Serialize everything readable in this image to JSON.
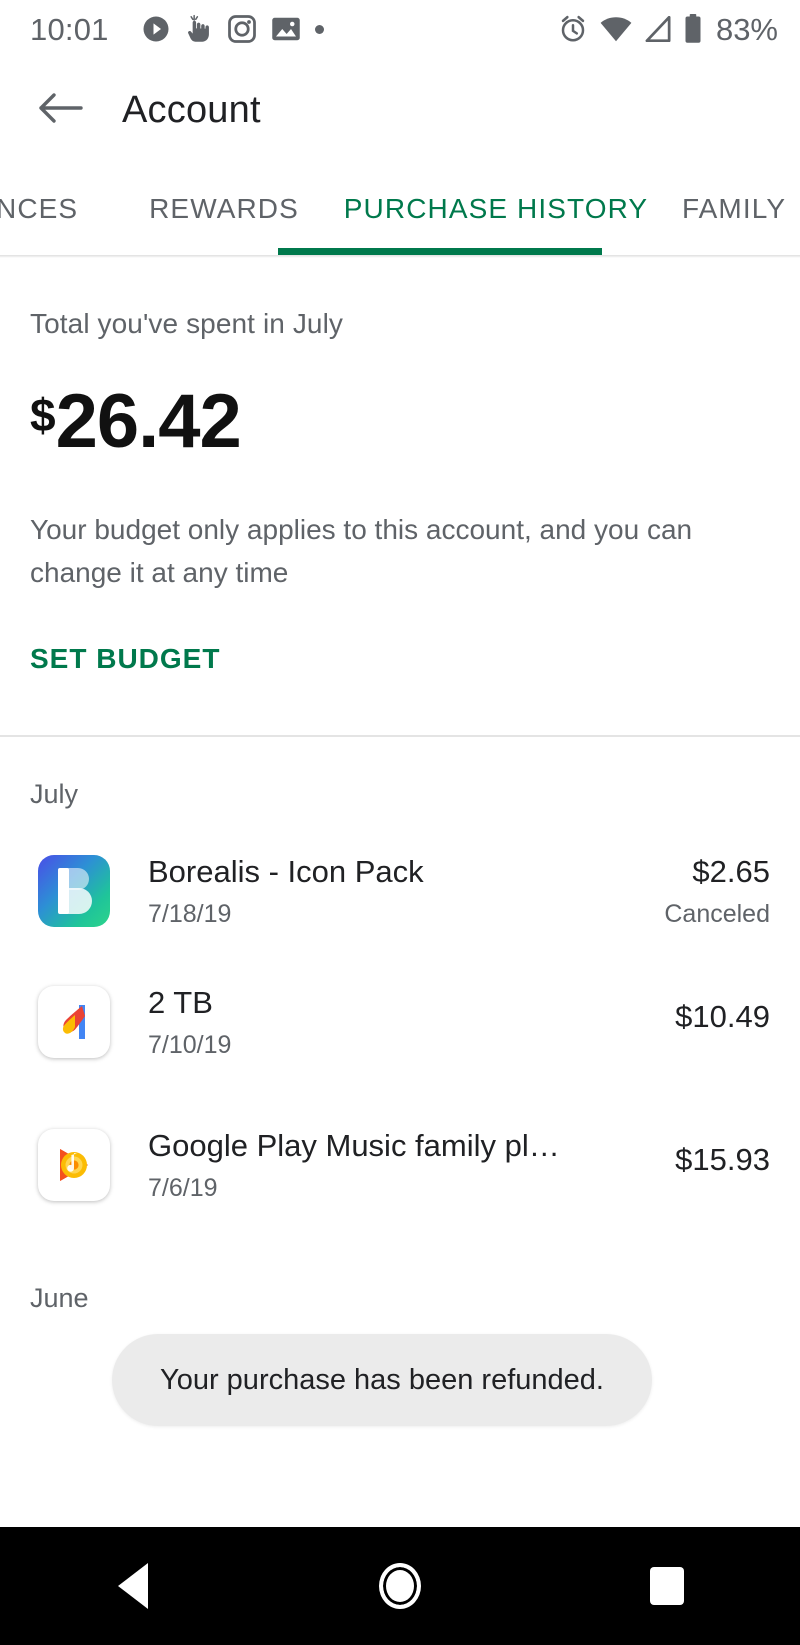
{
  "status_bar": {
    "time": "10:01",
    "battery_percent": "83%",
    "left_icons": [
      "play-circle-icon",
      "touch-pointer-icon",
      "instagram-icon",
      "image-icon",
      "dot-icon"
    ],
    "right_icons": [
      "alarm-icon",
      "wifi-icon",
      "cellular-signal-icon",
      "battery-icon"
    ]
  },
  "app_bar": {
    "back_icon": "arrow-back-icon",
    "title": "Account"
  },
  "tabs": {
    "items": [
      {
        "label": "NCES",
        "active": false
      },
      {
        "label": "REWARDS",
        "active": false
      },
      {
        "label": "PURCHASE HISTORY",
        "active": true
      },
      {
        "label": "FAMILY",
        "active": false
      }
    ],
    "active_index": 2,
    "accent_color": "#00794c"
  },
  "budget": {
    "label": "Total you've spent in July",
    "currency": "$",
    "amount": "26.42",
    "description": "Your budget only applies to this account, and you can change it at any time",
    "set_budget_label": "SET BUDGET"
  },
  "history": {
    "sections": [
      {
        "month": "July",
        "items": [
          {
            "icon": "borealis-icon-pack-icon",
            "title": "Borealis - Icon Pack",
            "date": "7/18/19",
            "price": "$2.65",
            "status": "Canceled"
          },
          {
            "icon": "google-one-icon",
            "title": "2 TB",
            "date": "7/10/19",
            "price": "$10.49",
            "status": ""
          },
          {
            "icon": "google-play-music-icon",
            "title": "Google Play Music family pl…",
            "date": "7/6/19",
            "price": "$15.93",
            "status": ""
          }
        ]
      },
      {
        "month": "June",
        "items": []
      }
    ]
  },
  "toast": {
    "message": "Your purchase has been refunded."
  },
  "nav_bar": {
    "back_label": "back-triangle-icon",
    "home_label": "home-circle-icon",
    "recents_label": "recents-square-icon"
  }
}
